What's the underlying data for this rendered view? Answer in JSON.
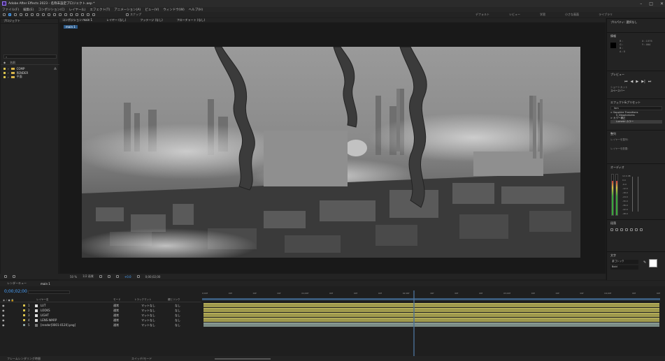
{
  "window": {
    "title": "Adobe After Effects 2023 - 名称未設定プロジェクト.aep *"
  },
  "menu": [
    "ファイル(F)",
    "編集(E)",
    "コンポジション(C)",
    "レイヤー(L)",
    "エフェクト(T)",
    "アニメーション(A)",
    "ビュー(V)",
    "ウィンドウ(W)",
    "ヘルプ(H)"
  ],
  "toolbar": {
    "snap_label": "スナップ"
  },
  "workspaces": [
    "デフォルト",
    "レビュー",
    "学習",
    "小さな画面",
    "ライブラリ"
  ],
  "project": {
    "title": "プロジェクト",
    "search_placeholder": "",
    "column_name": "名前",
    "items": [
      {
        "name": "COMP"
      },
      {
        "name": "RENDER"
      },
      {
        "name": "平面"
      }
    ]
  },
  "viewer": {
    "tabs": [
      "コンポジション main 1",
      "レイヤー (なし)",
      "フッテージ (なし)",
      "フローチャート (なし)"
    ],
    "comp_chip": "main 1",
    "zoom": "50 %",
    "resolution": "1/2 画質",
    "timecode": "0;00;02;00",
    "exposure": "+0.0"
  },
  "right_panels": {
    "properties_title": "プロパティ: 選択なし",
    "info_title": "情報",
    "info_values": [
      "R :",
      "G :",
      "B :",
      "A : 0",
      "X : 1375",
      "Y : 464"
    ],
    "preview_title": "プレビュー",
    "shortcut_label": "ショートカット",
    "shortcut_value": "スペースバー",
    "effects_title": "エフェクト&プリセット",
    "effects_search": "fam",
    "effects_items": [
      "> Sapphire Transitions",
      "S_DissolveLens",
      "> カラー補正",
      "Lumetri カラー"
    ],
    "align_title": "整列",
    "align_labels": [
      "レイヤーを整列:",
      "レイヤーを配置:"
    ],
    "audio_title": "オーディオ",
    "audio_db": [
      "12.0 dB",
      "0.0",
      "-6.0",
      "-12.0",
      "-18.0",
      "-24.0",
      "-30.0",
      "-36.0",
      "-42.0",
      "-48.0"
    ],
    "paragraph_title": "段落",
    "character_title": "文字",
    "font_name": "游ゴシック",
    "font_style": "Bold"
  },
  "timeline": {
    "tabs": [
      "レンダーキュー",
      "main 1"
    ],
    "timecode": "0;00;02;00",
    "columns": {
      "layer_name": "レイヤー名",
      "mode": "モード",
      "trkmat": "トラックマット",
      "parent": "親とリンク"
    },
    "layers": [
      {
        "num": "1",
        "name": "LUT",
        "mode": "通常",
        "trkmat": "マットなし",
        "parent": "なし"
      },
      {
        "num": "2",
        "name": "LOOKS",
        "mode": "通常",
        "trkmat": "マットなし",
        "parent": "なし"
      },
      {
        "num": "3",
        "name": "LIGHT",
        "mode": "通常",
        "trkmat": "マットなし",
        "parent": "なし"
      },
      {
        "num": "4",
        "name": "LENS-WARP",
        "mode": "通常",
        "trkmat": "マットなし",
        "parent": "なし"
      },
      {
        "num": "5",
        "name": "[render[0001-0120].png]",
        "mode": "通常",
        "trkmat": "マットなし",
        "parent": "なし"
      }
    ],
    "ruler": [
      "0;00f",
      "00f",
      "00f",
      "00f",
      "01;00f",
      "00f",
      "00f",
      "00f",
      "02;00f",
      "00f",
      "00f",
      "00f",
      "03;00f",
      "00f",
      "00f",
      "00f",
      "04;00f",
      "00f",
      "00f"
    ],
    "status": [
      "フレームレンダリング時間",
      "スイッチ/モード"
    ]
  },
  "colors": {
    "accent": "#4aa3ff",
    "label_yellow": "#d8c24b",
    "layer_bar": "#a09a4d",
    "footage_bar": "#7b8c86"
  }
}
